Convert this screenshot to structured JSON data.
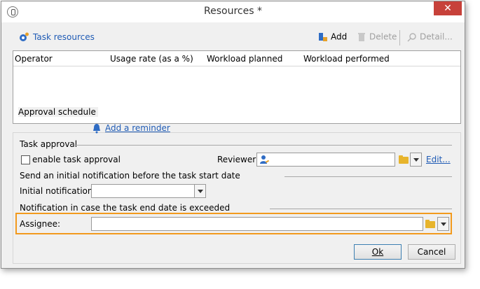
{
  "window": {
    "title": "Resources *",
    "close_glyph": "✕"
  },
  "toolbar": {
    "title": "Task resources",
    "add_label": "Add",
    "delete_label": "Delete",
    "detail_label": "Detail..."
  },
  "grid": {
    "columns": [
      "Operator",
      "Usage rate (as a %)",
      "Workload planned",
      "Workload performed"
    ]
  },
  "approval_schedule": {
    "label": "Approval schedule",
    "add_reminder": "Add a reminder"
  },
  "task_approval": {
    "label": "Task approval",
    "enable_label": "enable task approval",
    "enabled": false,
    "reviewer_label": "Reviewer:",
    "reviewer_value": "",
    "edit_link": "Edit..."
  },
  "initial_notification": {
    "section_label": "Send an initial notification before the task start date",
    "field_label": "Initial notification:",
    "value": ""
  },
  "end_notification": {
    "section_label": "Notification in case the task end date is exceeded",
    "assignee_label": "Assignee:",
    "assignee_value": ""
  },
  "footer": {
    "ok_label": "Ok",
    "cancel_label": "Cancel"
  },
  "colors": {
    "link": "#1f5bb5",
    "highlight": "#f29a1d",
    "close": "#c7413a"
  }
}
